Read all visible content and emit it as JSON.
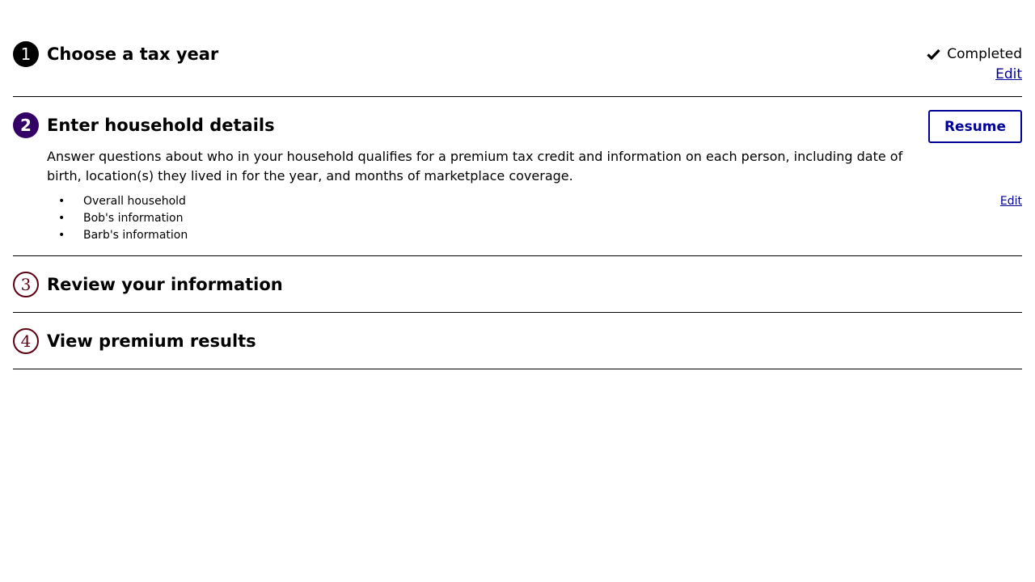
{
  "steps": [
    {
      "number": "1",
      "title": "Choose a tax year",
      "status_label": "Completed",
      "edit_label": "Edit"
    },
    {
      "number": "2",
      "title": "Enter household details",
      "resume_label": "Resume",
      "description": "Answer questions about who in your household qualifies for a premium tax credit and information on each person, including date of birth, location(s) they lived in for the year, and months of marketplace coverage.",
      "edit_label": "Edit",
      "items": [
        {
          "bullet": "•",
          "label": "Overall household"
        },
        {
          "bullet": "•",
          "label": "Bob's information"
        },
        {
          "bullet": "•",
          "label": "Barb's information"
        }
      ]
    },
    {
      "number": "3",
      "title": "Review your information"
    },
    {
      "number": "4",
      "title": "View premium results"
    }
  ],
  "colors": {
    "active_step": "#330066",
    "pending_step": "#5c0011",
    "link": "#000099"
  },
  "icons": {
    "completed": "check-icon"
  }
}
